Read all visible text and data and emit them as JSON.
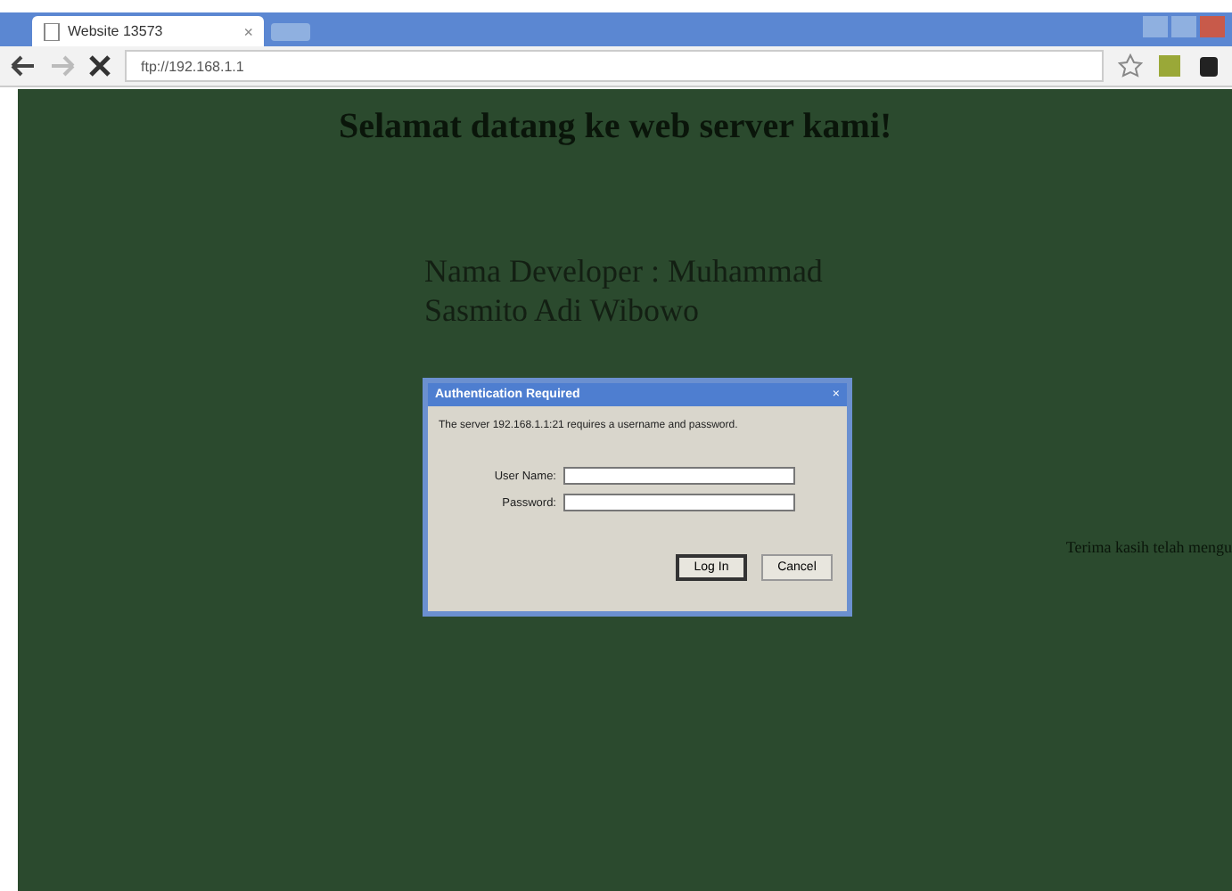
{
  "tab": {
    "title": "Website 13573",
    "close": "×"
  },
  "toolbar": {
    "url": "ftp://192.168.1.1"
  },
  "page": {
    "heading": "Selamat datang ke web server kami!",
    "developer": "Nama Developer : Muhammad Sasmito Adi Wibowo",
    "side_text": "Terima kasih telah mengu"
  },
  "dialog": {
    "title": "Authentication Required",
    "close": "×",
    "message": "The server 192.168.1.1:21 requires a username and password.",
    "fields": [
      {
        "label": "User Name:"
      },
      {
        "label": "Password:"
      }
    ],
    "buttons": [
      {
        "label": "Log In",
        "default": true
      },
      {
        "label": "Cancel",
        "default": false
      }
    ]
  }
}
